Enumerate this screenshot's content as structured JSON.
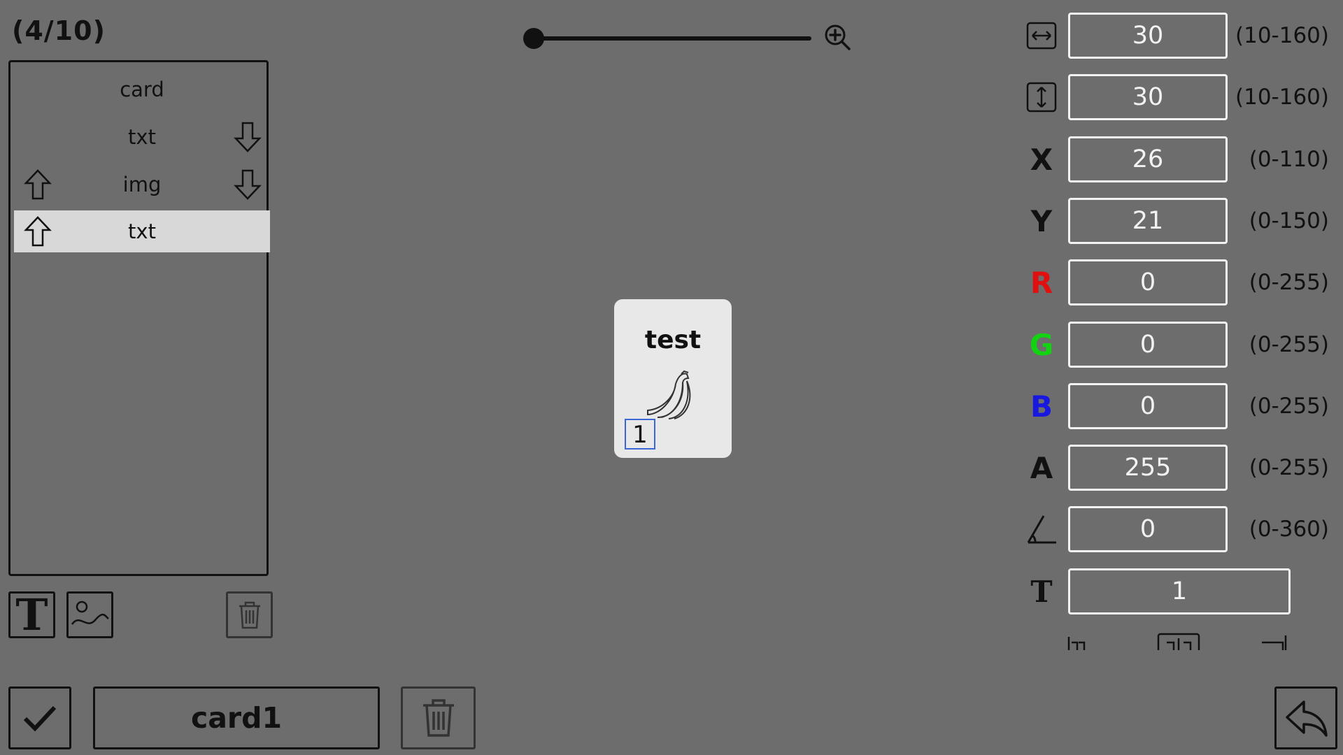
{
  "header": {
    "counter": "(4/10)"
  },
  "layers": {
    "items": [
      {
        "label": "card",
        "up": false,
        "down": false,
        "selected": false
      },
      {
        "label": "txt",
        "up": false,
        "down": true,
        "selected": false
      },
      {
        "label": "img",
        "up": true,
        "down": true,
        "selected": false
      },
      {
        "label": "txt",
        "up": true,
        "down": false,
        "selected": true
      }
    ]
  },
  "zoom": {
    "level": 0.0
  },
  "card": {
    "title": "test",
    "image_icon": "banana-icon",
    "number": "1"
  },
  "properties": [
    {
      "key": "width",
      "icon": "width-icon",
      "value": "30",
      "range": "(10-160)"
    },
    {
      "key": "height",
      "icon": "height-icon",
      "value": "30",
      "range": "(10-160)"
    },
    {
      "key": "x",
      "label": "X",
      "value": "26",
      "range": "(0-110)"
    },
    {
      "key": "y",
      "label": "Y",
      "value": "21",
      "range": "(0-150)"
    },
    {
      "key": "r",
      "label": "R",
      "color": "#e01010",
      "value": "0",
      "range": "(0-255)"
    },
    {
      "key": "g",
      "label": "G",
      "color": "#12d212",
      "value": "0",
      "range": "(0-255)"
    },
    {
      "key": "b",
      "label": "B",
      "color": "#1818e0",
      "value": "0",
      "range": "(0-255)"
    },
    {
      "key": "a",
      "label": "A",
      "value": "255",
      "range": "(0-255)"
    },
    {
      "key": "angle",
      "icon": "angle-icon",
      "value": "0",
      "range": "(0-360)"
    },
    {
      "key": "text",
      "label": "T",
      "value": "1"
    }
  ],
  "footer": {
    "card_name": "card1"
  },
  "colors": {
    "background": "#6d6d6d",
    "input_border": "#f2f2f2",
    "selected_row": "#d8d8d8"
  }
}
